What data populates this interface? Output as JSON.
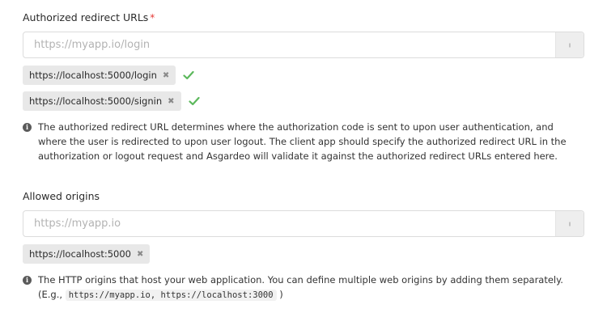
{
  "redirect": {
    "label": "Authorized redirect URLs",
    "required_mark": "*",
    "placeholder": "https://myapp.io/login",
    "value": "",
    "add_button_label": "",
    "chips": [
      {
        "url": "https://localhost:5000/login",
        "remove_label": "✖",
        "validated": true
      },
      {
        "url": "https://localhost:5000/signin",
        "remove_label": "✖",
        "validated": true
      }
    ],
    "hint": "The authorized redirect URL determines where the authorization code is sent to upon user authentication, and where the user is redirected to upon user logout. The client app should specify the authorized redirect URL in the authorization or logout request and Asgardeo will validate it against the authorized redirect URLs entered here."
  },
  "origins": {
    "label": "Allowed origins",
    "placeholder": "https://myapp.io",
    "value": "",
    "chips": [
      {
        "url": "https://localhost:5000",
        "remove_label": "✖"
      }
    ],
    "hint_line1": "The HTTP origins that host your web application. You can define multiple web origins by adding them separately.",
    "hint_prefix": "(E.g.,",
    "hint_code": "https://myapp.io, https://localhost:3000",
    "hint_suffix": ")"
  },
  "colors": {
    "check": "#5cb85c",
    "required": "#e53935",
    "chip_bg": "#e8e8e8"
  },
  "icons": {
    "info": "info-circle-icon",
    "check": "check-icon",
    "remove": "close-icon"
  }
}
